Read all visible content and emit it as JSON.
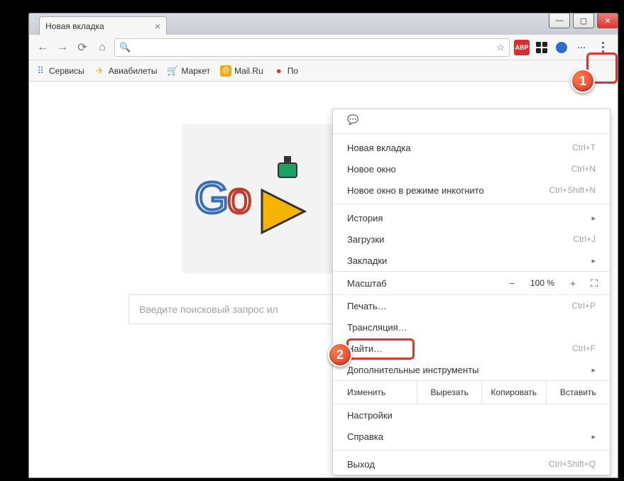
{
  "window": {
    "tab_title": "Новая вкладка"
  },
  "omnibox": {
    "value": "",
    "star_title": "Добавить в закладки"
  },
  "bookmarks": [
    {
      "label": "Сервисы",
      "icon": "⠿",
      "color": "#4285f4"
    },
    {
      "label": "Авиабилеты",
      "icon": "✈",
      "color": "#f5b400"
    },
    {
      "label": "Маркет",
      "icon": "🛒",
      "color": "#1b73e8"
    },
    {
      "label": "Mail.Ru",
      "icon": "@",
      "color": "#f7a70a"
    },
    {
      "label": "По",
      "icon": "●",
      "color": "#d23a2e"
    }
  ],
  "search_placeholder": "Введите поисковый запрос ил",
  "menu": {
    "new_tab": {
      "label": "Новая вкладка",
      "shortcut": "Ctrl+T"
    },
    "new_window": {
      "label": "Новое окно",
      "shortcut": "Ctrl+N"
    },
    "incognito": {
      "label": "Новое окно в режиме инкогнито",
      "shortcut": "Ctrl+Shift+N"
    },
    "history": {
      "label": "История"
    },
    "downloads": {
      "label": "Загрузки",
      "shortcut": "Ctrl+J"
    },
    "bookmarks": {
      "label": "Закладки"
    },
    "zoom": {
      "label": "Масштаб",
      "percent": "100 %",
      "minus": "−",
      "plus": "+"
    },
    "print": {
      "label": "Печать…",
      "shortcut": "Ctrl+P"
    },
    "cast": {
      "label": "Трансляция…"
    },
    "find": {
      "label": "Найти…",
      "shortcut": "Ctrl+F"
    },
    "more_tools": {
      "label": "Дополнительные инструменты"
    },
    "edit": {
      "label": "Изменить",
      "cut": "Вырезать",
      "copy": "Копировать",
      "paste": "Вставить"
    },
    "settings": {
      "label": "Настройки"
    },
    "help": {
      "label": "Справка"
    },
    "exit": {
      "label": "Выход",
      "shortcut": "Ctrl+Shift+Q"
    }
  },
  "annotations": {
    "one": "1",
    "two": "2"
  }
}
